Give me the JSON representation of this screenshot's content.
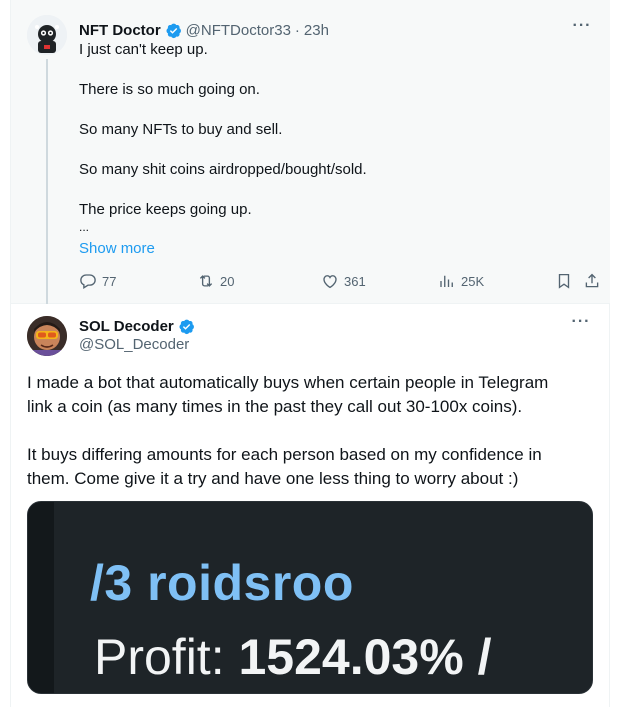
{
  "parent": {
    "display_name": "NFT Doctor",
    "handle": "@NFTDoctor33",
    "separator": "·",
    "time": "23h",
    "lines": [
      "I just can't keep up.",
      "There is so much going on.",
      "So many NFTs to buy and sell.",
      "So many shit coins airdropped/bought/sold.",
      "The price keeps going up.",
      "..."
    ],
    "show_more": "Show more",
    "replies": "77",
    "retweets": "20",
    "likes": "361",
    "views": "25K"
  },
  "reply": {
    "display_name": "SOL Decoder",
    "handle": "@SOL_Decoder",
    "paragraph1_line1": "I made a bot that automatically buys when certain people in Telegram",
    "paragraph1_line2": "link a coin (as many times in the past they call out 30-100x coins).",
    "paragraph2_line1": "It buys differing amounts for each person based on my confidence in",
    "paragraph2_line2": "them. Come give it a try and have one less thing to worry about :)",
    "media_line1": "/3 roidsroo",
    "media_line2_label": "Profit: ",
    "media_line2_value": "1524.03% /"
  },
  "icons": {
    "more": "more-icon",
    "verified": "verified-badge-icon",
    "reply": "reply-icon",
    "retweet": "retweet-icon",
    "like": "heart-icon",
    "views": "views-icon",
    "bookmark": "bookmark-icon",
    "share": "share-icon"
  },
  "colors": {
    "link": "#1d9bf0",
    "secondary": "#536471",
    "verified": "#1d9bf0",
    "media_blue": "#7fc0f5"
  }
}
